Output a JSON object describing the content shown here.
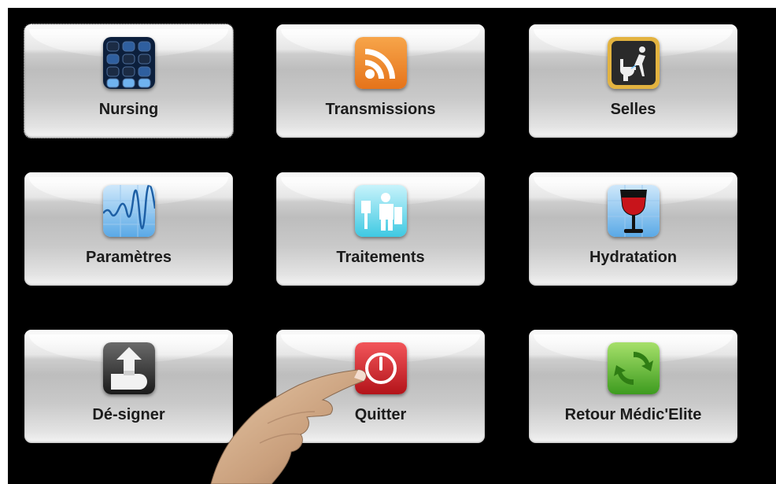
{
  "menu": {
    "buttons": [
      {
        "label": "Nursing",
        "icon": "keypad-icon"
      },
      {
        "label": "Transmissions",
        "icon": "rss-icon"
      },
      {
        "label": "Selles",
        "icon": "toilet-icon"
      },
      {
        "label": "Paramètres",
        "icon": "chart-icon"
      },
      {
        "label": "Traitements",
        "icon": "pharmacy-icon"
      },
      {
        "label": "Hydratation",
        "icon": "glass-icon"
      },
      {
        "label": "Dé-signer",
        "icon": "sign-out-icon"
      },
      {
        "label": "Quitter",
        "icon": "power-icon"
      },
      {
        "label": "Retour Médic'Elite",
        "icon": "refresh-icon"
      }
    ]
  },
  "colors": {
    "background": "#000000",
    "rss_orange": "#f08a24",
    "power_red": "#d7262a",
    "refresh_green": "#59b02c"
  }
}
